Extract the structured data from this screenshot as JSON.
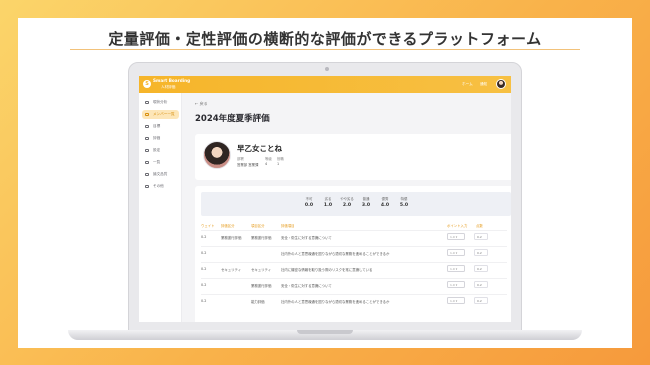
{
  "headline": "定量評価・定性評価の横断的な評価ができるプラットフォーム",
  "app": {
    "brand_name": "Smart Boarding",
    "brand_sub": "人材評価",
    "header_link_1": "ホーム",
    "header_link_2": "通知"
  },
  "sidebar": {
    "items": [
      {
        "label": "現状分析"
      },
      {
        "label": "メンバー一覧"
      },
      {
        "label": "目標"
      },
      {
        "label": "評価"
      },
      {
        "label": "設定"
      },
      {
        "label": "一覧"
      },
      {
        "label": "論文品質"
      },
      {
        "label": "その他"
      }
    ]
  },
  "main": {
    "back_label": "戻る",
    "page_title": "2024年度夏季評価",
    "profile": {
      "name": "早乙女ことね",
      "meta_labels": [
        "部署",
        "等級",
        "役職"
      ],
      "meta_values": [
        "営業部 営業課",
        "4",
        "1"
      ]
    },
    "scale": {
      "labels": [
        "不可",
        "劣る",
        "やや劣る",
        "普通",
        "優秀",
        "特優"
      ],
      "values": [
        "0.0",
        "1.0",
        "2.0",
        "3.0",
        "4.0",
        "5.0"
      ]
    },
    "columns": [
      "ウェイト",
      "評価区分",
      "項目区分",
      "評価項目",
      "ポイント入力",
      "点数"
    ],
    "rows": [
      {
        "weight": "0.2",
        "category": "業務遂行評価",
        "sub": "業務遂行評価",
        "item": "安全・衛生に対する意識について",
        "select": "1.0",
        "points": "0.2"
      },
      {
        "weight": "0.2",
        "category": "",
        "sub": "",
        "item": "社内外の人と意思疎通を図りながら適切な業務を進めることができるか",
        "select": "1.0",
        "points": "0.2"
      },
      {
        "weight": "0.2",
        "category": "セキュリティ",
        "sub": "セキュリティ",
        "item": "社内に機密な情報を取り扱う際のリスクを常に意識している",
        "select": "1.0",
        "points": "0.2"
      },
      {
        "weight": "0.2",
        "category": "",
        "sub": "業務遂行評価",
        "item": "安全・衛生に対する意識について",
        "select": "1.0",
        "points": "0.2"
      },
      {
        "weight": "0.2",
        "category": "",
        "sub": "能力評価",
        "item": "社内外の人と意思疎通を図りながら適切な業務を進めることができるか",
        "select": "1.0",
        "points": "0.2"
      }
    ]
  },
  "colors": {
    "accent": "#f6b52a",
    "background_start": "#fbd56a",
    "background_end": "#f69a3c"
  }
}
